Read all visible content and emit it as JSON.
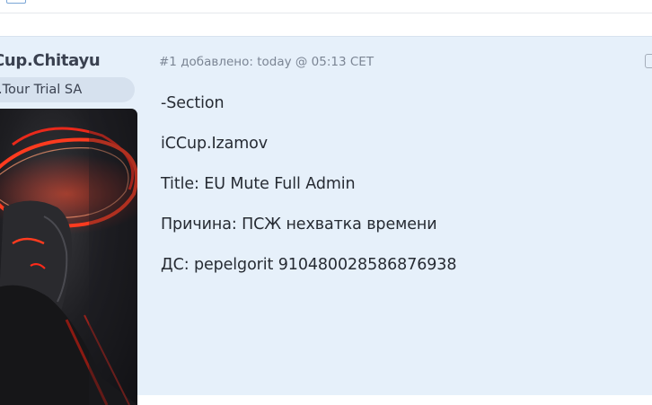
{
  "post": {
    "number": "#1",
    "meta": "#1 добавлено: today @ 05:13 CET",
    "author": {
      "username": "Cup.Chitayu",
      "title": ".Tour Trial SA"
    },
    "message_lines": [
      "-Section",
      "iCCup.Izamov",
      "Title: EU Mute Full Admin",
      "Причина: ПСЖ нехватка времени",
      "ДС: pepelgorit 910480028586876938"
    ]
  },
  "colors": {
    "post_background": "#e6f0fa",
    "user_title_background": "#d6e1ee",
    "text": "#262b33",
    "meta_text": "#7b8594",
    "avatar_accent": "#ff2a1a"
  },
  "icons": {
    "share": "share-icon",
    "checkbox": "checkbox-icon"
  }
}
